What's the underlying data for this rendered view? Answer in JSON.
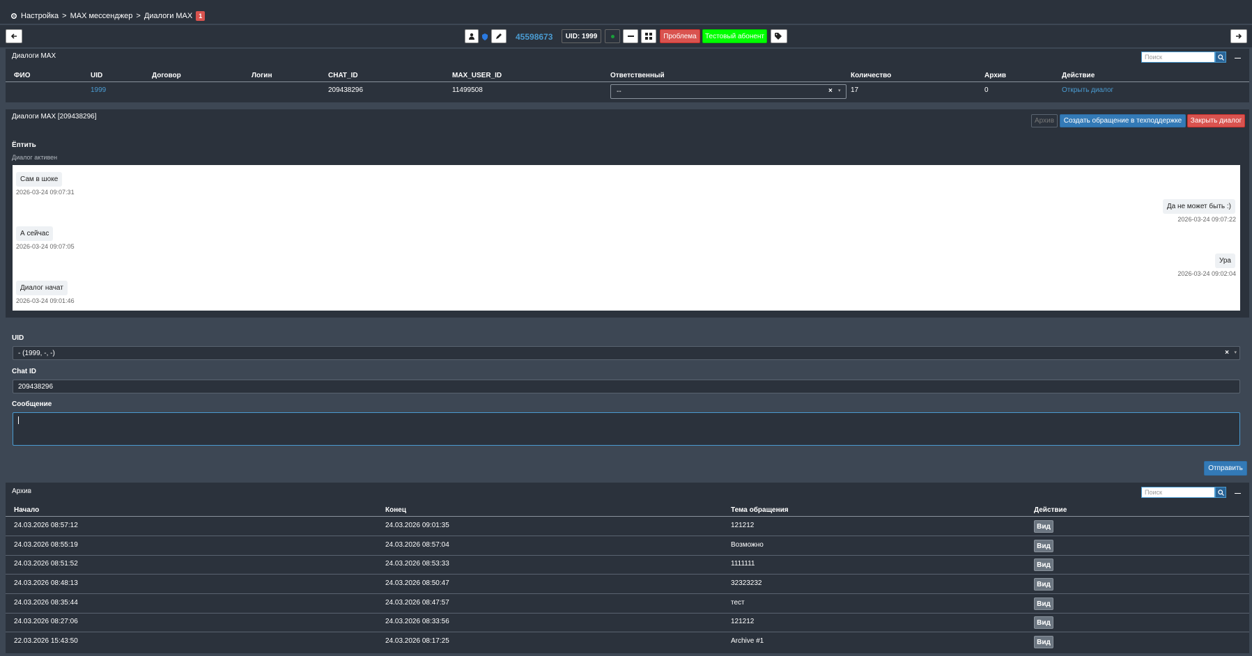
{
  "breadcrumb": {
    "settings": "Настройка",
    "sep1": ">",
    "messenger": "MAX мессенджер",
    "sep2": ">",
    "dialogs": "Диалоги MAX",
    "badge": "1"
  },
  "toolbar": {
    "phone": "45598673",
    "uid": "UID: 1999",
    "problem": "Проблема",
    "test": "Тестовый абонент"
  },
  "dialogs_panel": {
    "title": "Диалоги MAX",
    "search_placeholder": "Поиск",
    "columns": [
      "ФИО",
      "UID",
      "Договор",
      "Логин",
      "CHAT_ID",
      "MAX_USER_ID",
      "Ответственный",
      "Количество",
      "Архив",
      "Действие"
    ],
    "row": {
      "fio": "",
      "uid": "1999",
      "contract": "",
      "login": "",
      "chat_id": "209438296",
      "max_user_id": "11499508",
      "responsible": "--",
      "count": "17",
      "archive": "0",
      "action": "Открыть диалог"
    }
  },
  "dialog_panel": {
    "title": "Диалоги MAX [209438296]",
    "archive_btn": "Архив",
    "support_btn": "Создать обращение в техподдержке",
    "close_btn": "Закрыть диалог",
    "user_name": "Ёптить",
    "status": "Диалог активен",
    "messages": [
      {
        "text": "Сам в шоке",
        "time": "2026-03-24 09:07:31",
        "side": "left"
      },
      {
        "text": "Да не может быть :)",
        "time": "2026-03-24 09:07:22",
        "side": "right"
      },
      {
        "text": "А сейчас",
        "time": "2026-03-24 09:07:05",
        "side": "left"
      },
      {
        "text": "Ура",
        "time": "2026-03-24 09:02:04",
        "side": "right"
      },
      {
        "text": "Диалог начат",
        "time": "2026-03-24 09:01:46",
        "side": "left"
      }
    ]
  },
  "form": {
    "uid_label": "UID",
    "uid_value": "- (1999, -, -)",
    "chat_label": "Chat ID",
    "chat_value": "209438296",
    "message_label": "Сообщение",
    "message_value": "",
    "send": "Отправить"
  },
  "archive_panel": {
    "title": "Архив",
    "search_placeholder": "Поиск",
    "columns": [
      "Начало",
      "Конец",
      "Тема обращения",
      "Действие"
    ],
    "rows": [
      {
        "start": "24.03.2026 08:57:12",
        "end": "24.03.2026 09:01:35",
        "topic": "121212",
        "action": "Вид"
      },
      {
        "start": "24.03.2026 08:55:19",
        "end": "24.03.2026 08:57:04",
        "topic": "Возможно",
        "action": "Вид"
      },
      {
        "start": "24.03.2026 08:51:52",
        "end": "24.03.2026 08:53:33",
        "topic": "1111111",
        "action": "Вид"
      },
      {
        "start": "24.03.2026 08:48:13",
        "end": "24.03.2026 08:50:47",
        "topic": "32323232",
        "action": "Вид"
      },
      {
        "start": "24.03.2026 08:35:44",
        "end": "24.03.2026 08:47:57",
        "topic": "тест",
        "action": "Вид"
      },
      {
        "start": "24.03.2026 08:27:06",
        "end": "24.03.2026 08:33:56",
        "topic": "121212",
        "action": "Вид"
      },
      {
        "start": "22.03.2026 15:43:50",
        "end": "24.03.2026 08:17:25",
        "topic": "Archive #1",
        "action": "Вид"
      }
    ]
  },
  "colors": {
    "accent": "#4a9bd1",
    "danger": "#d9534f",
    "success": "#00ff00",
    "primary": "#337ab7",
    "panel": "#2b323c",
    "bg": "#3d4754"
  }
}
